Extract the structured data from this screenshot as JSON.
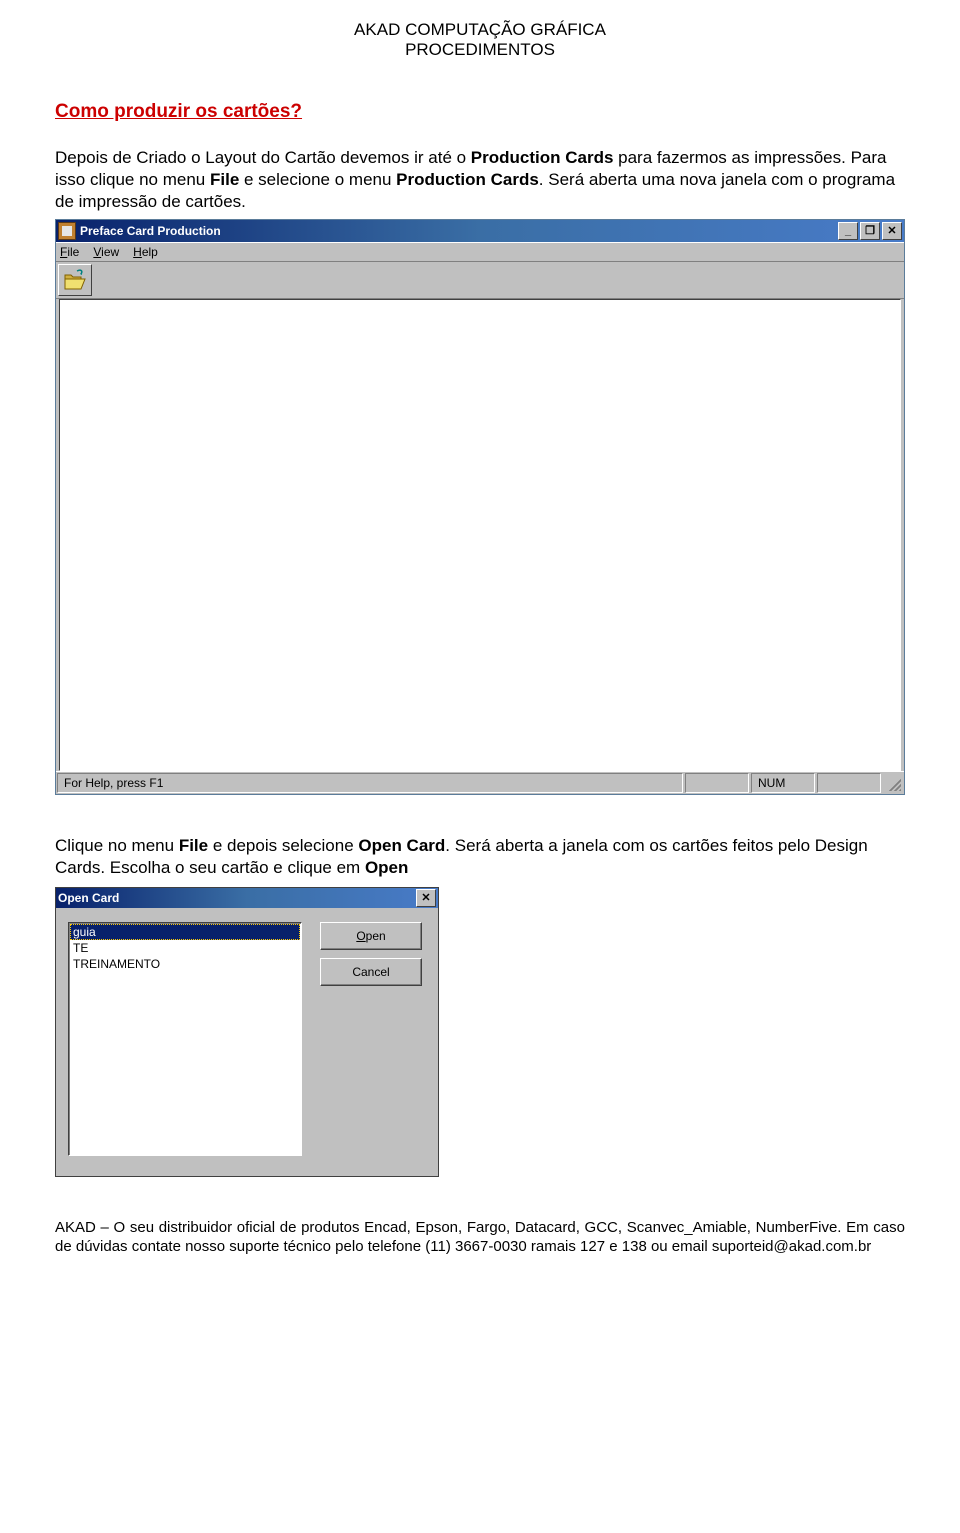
{
  "doc_header": {
    "line1": "AKAD COMPUTAÇÃO GRÁFICA",
    "line2": "PROCEDIMENTOS"
  },
  "section_title": "Como produzir os cartões?",
  "para1_pre": "Depois de Criado o Layout do Cartão devemos ir até o ",
  "para1_b1": "Production Cards",
  "para1_mid1": " para fazermos as impressões. Para isso clique no menu ",
  "para1_b2": "File",
  "para1_mid2": " e selecione o menu ",
  "para1_b3": "Production Cards",
  "para1_post": ". Será aberta uma nova janela com o programa de impressão de cartões.",
  "window": {
    "title": "Preface Card Production",
    "min": "_",
    "max": "❐",
    "close": "✕",
    "menu": {
      "file": "File",
      "view": "View",
      "help": "Help"
    },
    "status_left": "For Help, press F1",
    "status_num": "NUM"
  },
  "para2_pre": "Clique no menu ",
  "para2_b1": "File",
  "para2_mid1": " e depois selecione ",
  "para2_b2": "Open Card",
  "para2_mid2": ". Será aberta a janela com os cartões feitos pelo Design Cards. Escolha o seu cartão e clique em ",
  "para2_b3": "Open",
  "dialog": {
    "title": "Open Card",
    "close": "✕",
    "items": [
      "guia",
      "TE",
      "TREINAMENTO"
    ],
    "open_label": "Open",
    "cancel_label": "Cancel"
  },
  "footer_text": "AKAD – O seu distribuidor oficial de produtos Encad, Epson, Fargo, Datacard, GCC, Scanvec_Amiable, NumberFive. Em caso de dúvidas contate nosso suporte técnico pelo telefone (11) 3667-0030 ramais 127 e 138 ou email suporteid@akad.com.br"
}
